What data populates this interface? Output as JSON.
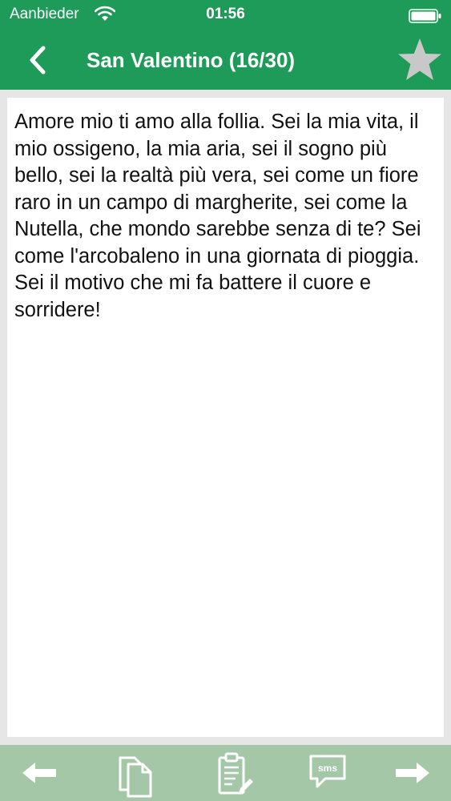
{
  "status_bar": {
    "carrier": "Aanbieder",
    "time": "01:56",
    "wifi_icon": "wifi-icon",
    "battery_icon": "battery-full-icon"
  },
  "nav_bar": {
    "back_icon": "chevron-left-icon",
    "title": "San Valentino (16/30)",
    "favorite_icon": "star-icon",
    "favorite_active": false
  },
  "message": {
    "text": "Amore mio ti amo alla follia. Sei la mia vita, il mio ossigeno, la mia aria, sei il sogno più bello, sei la realtà più vera, sei come un fiore raro in un campo di margherite, sei come la Nutella, che mondo sarebbe senza di te? Sei come l'arcobaleno in una giornata di pioggia. Sei il motivo che mi fa battere il cuore e sorridere!"
  },
  "toolbar": {
    "previous_icon": "arrow-left-icon",
    "copy_icon": "copy-icon",
    "note_icon": "clipboard-edit-icon",
    "sms_icon": "sms-bubble-icon",
    "sms_label": "sms",
    "next_icon": "arrow-right-icon"
  },
  "colors": {
    "header_green": "#1e9b58",
    "toolbar_green": "#a4c7a8",
    "background_gray": "#e6e6e6",
    "star_gray": "#c8c8c8"
  }
}
